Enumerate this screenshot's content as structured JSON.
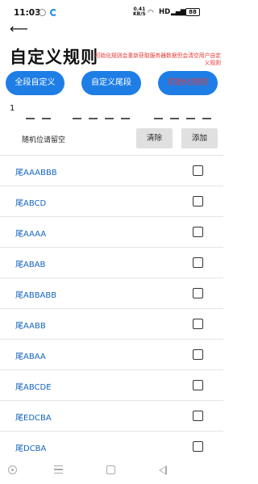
{
  "status_bar": {
    "time": "11:03",
    "net_speed_value": "0.41",
    "net_speed_unit": "KB/S",
    "hd_label": "HD",
    "signal_label": "4G",
    "battery_level": "88"
  },
  "header": {
    "title": "自定义规则",
    "note": "初始化规则会重新获取服务器数据但会清空用户自定义规则"
  },
  "actions": {
    "custom_segment": "全段自定义",
    "custom_tail": "自定义尾段",
    "init_rules": "初始化规则"
  },
  "pattern_input": {
    "value": "1",
    "dash_groups": [
      2,
      4,
      4
    ]
  },
  "add_row": {
    "note": "随机位请留空",
    "clear_label": "清除",
    "add_label": "添加"
  },
  "rules": [
    {
      "label": "尾AAABBB",
      "checked": false
    },
    {
      "label": "尾ABCD",
      "checked": false
    },
    {
      "label": "尾AAAA",
      "checked": false
    },
    {
      "label": "尾ABAB",
      "checked": false
    },
    {
      "label": "尾ABBABB",
      "checked": false
    },
    {
      "label": "尾AABB",
      "checked": false
    },
    {
      "label": "尾ABAA",
      "checked": false
    },
    {
      "label": "尾ABCDE",
      "checked": false
    },
    {
      "label": "尾EDCBA",
      "checked": false
    },
    {
      "label": "尾DCBA",
      "checked": false
    }
  ],
  "colors": {
    "accent": "#1e7ee6",
    "warning": "#e53935",
    "link": "#1565c0"
  }
}
